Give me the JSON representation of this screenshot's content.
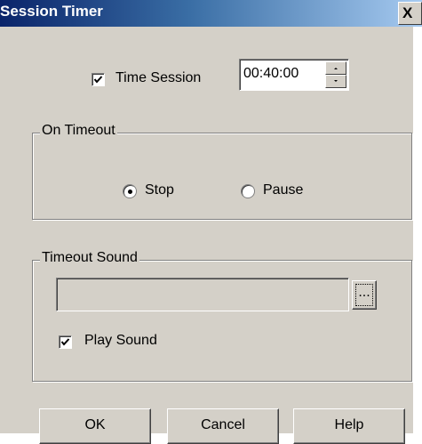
{
  "window": {
    "title": "Session Timer",
    "close_glyph": "X"
  },
  "time_session": {
    "label": "Time Session",
    "checked": true,
    "value": "00:40:00"
  },
  "on_timeout": {
    "legend": "On Timeout",
    "options": [
      {
        "label": "Stop",
        "selected": true
      },
      {
        "label": "Pause",
        "selected": false
      }
    ]
  },
  "timeout_sound": {
    "legend": "Timeout Sound",
    "path_value": "",
    "browse_label": "...",
    "play_sound_label": "Play Sound",
    "play_sound_checked": true
  },
  "buttons": {
    "ok": "OK",
    "cancel": "Cancel",
    "help": "Help"
  }
}
